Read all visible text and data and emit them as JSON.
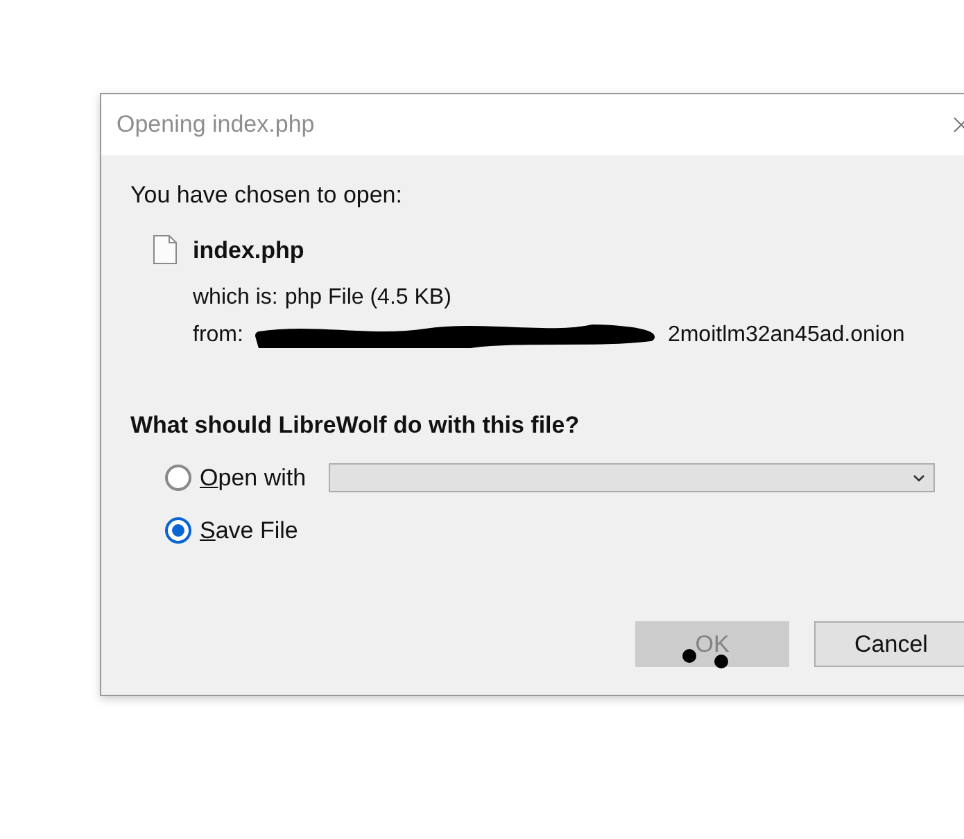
{
  "window": {
    "title": "Opening index.php"
  },
  "intro": "You have chosen to open:",
  "file": {
    "name": "index.php",
    "type_label": "which is:",
    "type_value": "php File (4.5 KB)",
    "from_label": "from:",
    "from_value": "2moitlm32an45ad.onion"
  },
  "question": "What should LibreWolf do with this file?",
  "options": [
    {
      "kind": "open_with",
      "label": "Open with",
      "selected": false
    },
    {
      "kind": "save",
      "label": "Save File",
      "selected": true
    }
  ],
  "buttons": [
    {
      "label": "OK",
      "disabled": true
    },
    {
      "label": "Cancel",
      "disabled": false
    }
  ]
}
